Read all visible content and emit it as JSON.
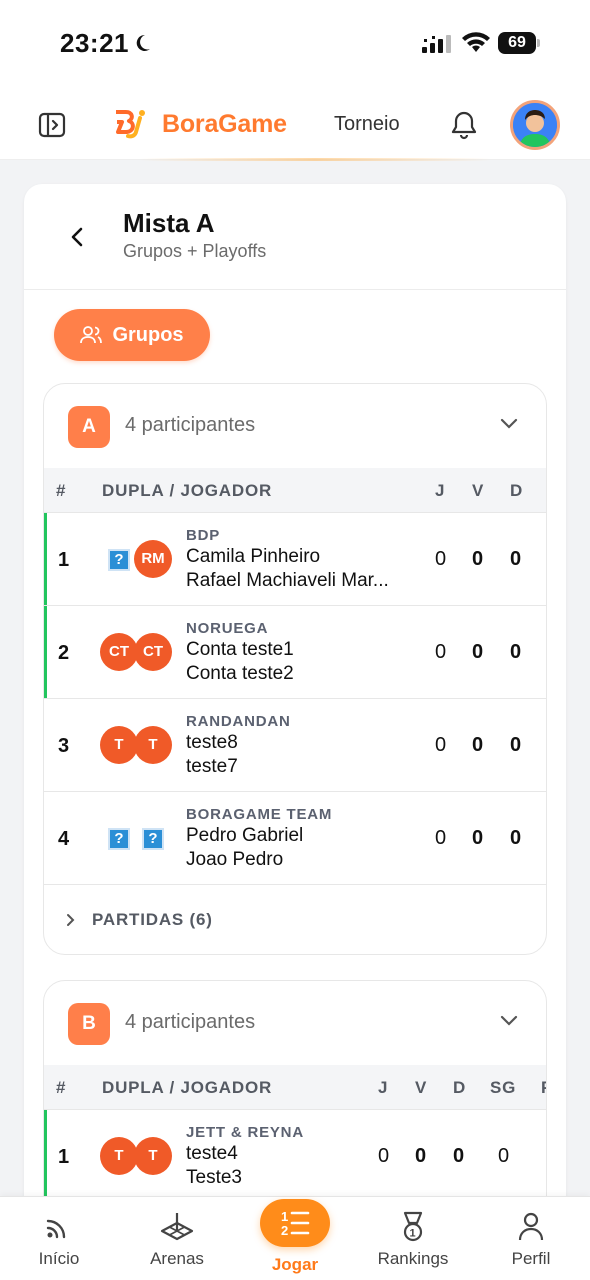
{
  "status_bar": {
    "time": "23:21",
    "battery": "69"
  },
  "header": {
    "brand": "BoraGame",
    "nav_link": "Torneio"
  },
  "page": {
    "title": "Mista A",
    "subtitle": "Grupos + Playoffs",
    "grupos_label": "Grupos"
  },
  "groups": [
    {
      "letter": "A",
      "count_label": "4 participantes",
      "columns": [
        "#",
        "DUPLA / JOGADOR",
        "J",
        "V",
        "D"
      ],
      "rows": [
        {
          "pos": "1",
          "team": "BDP",
          "p1": "Camila Pinheiro",
          "p2": "Rafael Machiaveli Mar...",
          "av1": "?",
          "av2": "RM",
          "j": "0",
          "v": "0",
          "d": "0"
        },
        {
          "pos": "2",
          "team": "NORUEGA",
          "p1": "Conta teste1",
          "p2": "Conta teste2",
          "av1": "CT",
          "av2": "CT",
          "j": "0",
          "v": "0",
          "d": "0"
        },
        {
          "pos": "3",
          "team": "RANDANDAN",
          "p1": "teste8",
          "p2": "teste7",
          "av1": "T",
          "av2": "T",
          "j": "0",
          "v": "0",
          "d": "0"
        },
        {
          "pos": "4",
          "team": "BORAGAME TEAM",
          "p1": "Pedro Gabriel",
          "p2": "Joao Pedro",
          "av1": "?",
          "av2": "?",
          "j": "0",
          "v": "0",
          "d": "0"
        }
      ],
      "partidas_label": "PARTIDAS (6)"
    },
    {
      "letter": "B",
      "count_label": "4 participantes",
      "columns": [
        "#",
        "DUPLA / JOGADOR",
        "J",
        "V",
        "D",
        "SG",
        "P"
      ],
      "rows": [
        {
          "pos": "1",
          "team": "JETT & REYNA",
          "p1": "teste4",
          "p2": "Teste3",
          "av1": "T",
          "av2": "T",
          "j": "0",
          "v": "0",
          "d": "0",
          "sg": "0"
        }
      ]
    }
  ],
  "bottom_nav": {
    "inicio": "Início",
    "arenas": "Arenas",
    "jogar": "Jogar",
    "rankings": "Rankings",
    "perfil": "Perfil"
  },
  "colors": {
    "accent": "#ff7f4a",
    "qualified": "#22c55e",
    "avatar": "#f05a28"
  }
}
